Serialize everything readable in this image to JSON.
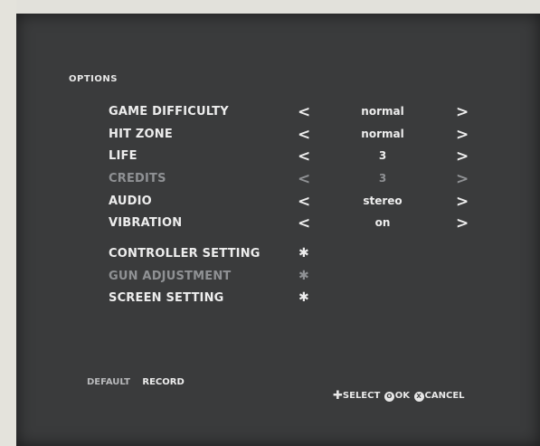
{
  "title": "OPTIONS",
  "options": [
    {
      "label": "GAME DIFFICULTY",
      "value": "normal",
      "enabled": true
    },
    {
      "label": "HIT ZONE",
      "value": "normal",
      "enabled": true
    },
    {
      "label": "LIFE",
      "value": "3",
      "enabled": true
    },
    {
      "label": "CREDITS",
      "value": "3",
      "enabled": false
    },
    {
      "label": "AUDIO",
      "value": "stereo",
      "enabled": true
    },
    {
      "label": "VIBRATION",
      "value": "on",
      "enabled": true
    }
  ],
  "settings": [
    {
      "label": "CONTROLLER SETTING",
      "enabled": true
    },
    {
      "label": "GUN ADJUSTMENT",
      "enabled": false
    },
    {
      "label": "SCREEN SETTING",
      "enabled": true
    }
  ],
  "arrows": {
    "left": "<",
    "right": ">",
    "submenu": "✱"
  },
  "footer": {
    "default_label": "DEFAULT",
    "record_label": "RECORD",
    "help_select": "SELECT",
    "help_ok": "OK",
    "help_cancel": "CANCEL",
    "help_ok_button": "O",
    "help_cancel_button": "X"
  },
  "colors": {
    "screen_bg": "#3a3b3c",
    "text": "#ededed",
    "dim_text": "#8f9194"
  }
}
